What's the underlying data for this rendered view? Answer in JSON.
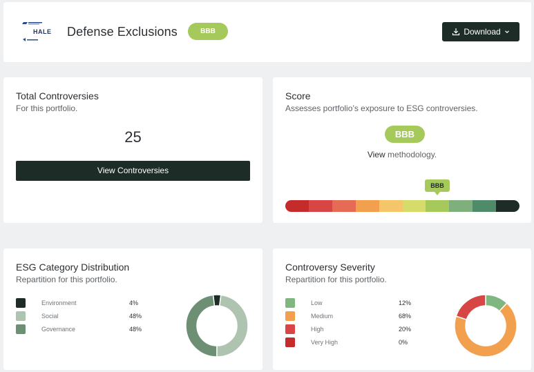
{
  "header": {
    "title": "Defense Exclusions",
    "rating": "BBB",
    "download_label": "Download",
    "logo_text": "HALE"
  },
  "total_controversies": {
    "title": "Total Controversies",
    "subtitle": "For this portfolio.",
    "count": "25",
    "button_label": "View Controversies"
  },
  "score": {
    "title": "Score",
    "subtitle": "Assesses portfolio’s exposure to ESG controversies.",
    "rating": "BBB",
    "view_link": "View",
    "methodology_text": " methodology.",
    "marker_label": "BBB",
    "scale_colors": [
      "#c42b2b",
      "#d84545",
      "#e56b55",
      "#f2a04d",
      "#f5c56a",
      "#d5dc6a",
      "#a6c95b",
      "#7faf7d",
      "#4f8b69",
      "#1d2c26"
    ]
  },
  "esg_distribution": {
    "title": "ESG Category Distribution",
    "subtitle": "Repartition for this portfolio.",
    "items": [
      {
        "label": "Environment",
        "percent": "4%",
        "value": 4,
        "color": "#1d2c26"
      },
      {
        "label": "Social",
        "percent": "48%",
        "value": 48,
        "color": "#aec4b0"
      },
      {
        "label": "Governance",
        "percent": "48%",
        "value": 48,
        "color": "#6d8f73"
      }
    ]
  },
  "severity": {
    "title": "Controversy Severity",
    "subtitle": "Repartition for this portfolio.",
    "items": [
      {
        "label": "Low",
        "percent": "12%",
        "value": 12,
        "color": "#80b680"
      },
      {
        "label": "Medium",
        "percent": "68%",
        "value": 68,
        "color": "#f2a04d"
      },
      {
        "label": "High",
        "percent": "20%",
        "value": 20,
        "color": "#d84545"
      },
      {
        "label": "Very High",
        "percent": "0%",
        "value": 0,
        "color": "#c42b2b"
      }
    ]
  }
}
